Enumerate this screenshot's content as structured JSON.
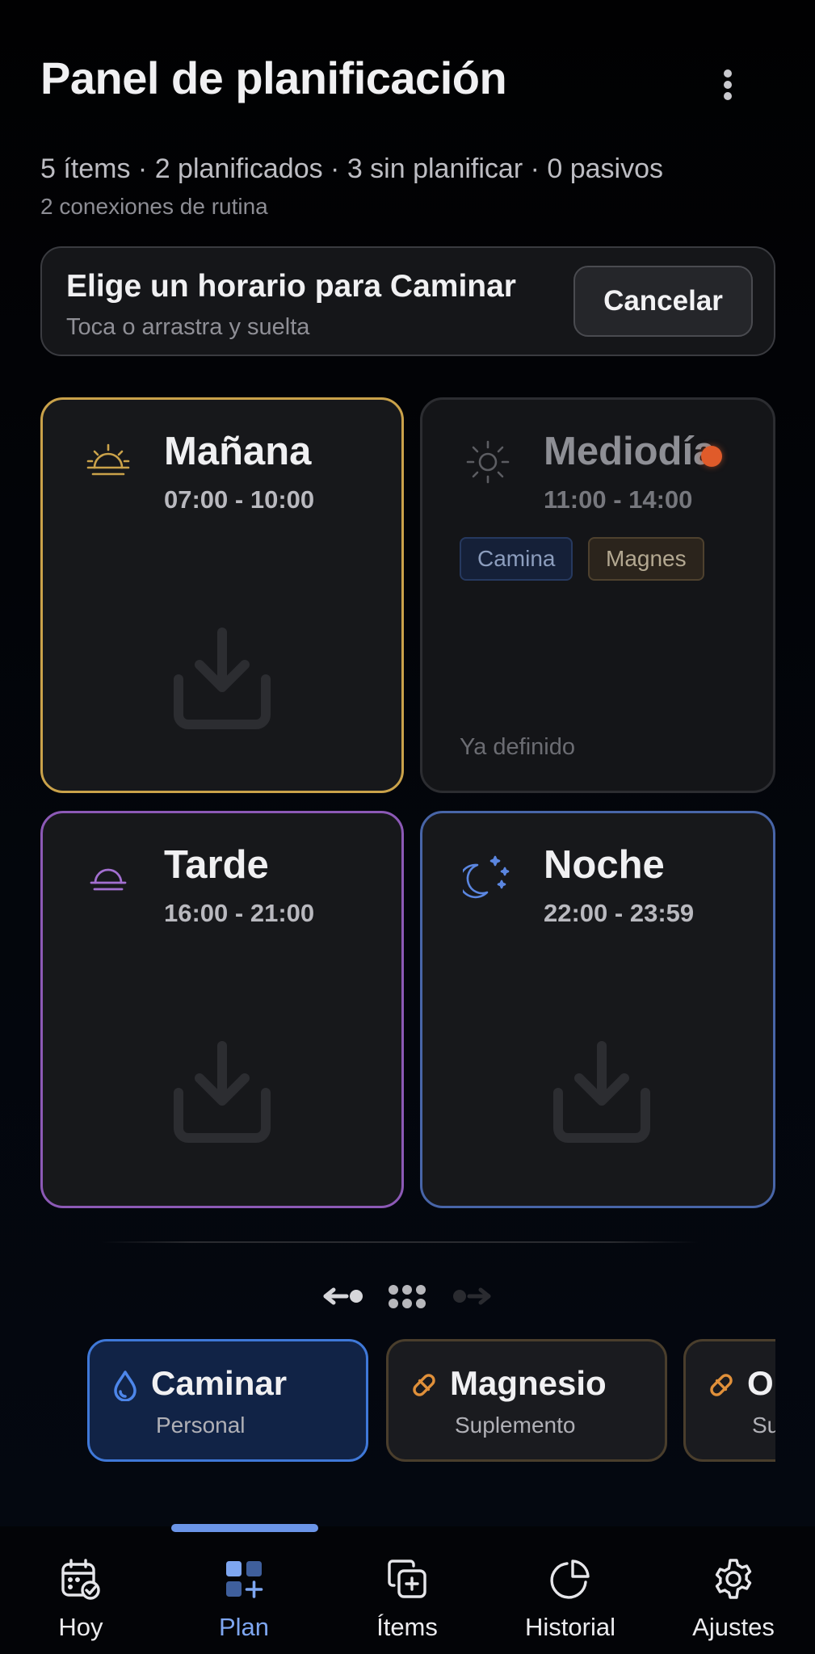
{
  "header": {
    "title": "Panel de planificación",
    "summary": "5 ítems · 2 planificados · 3 sin planificar · 0 pasivos",
    "routine_links": "2 conexiones de rutina"
  },
  "banner": {
    "title": "Elige un horario para Caminar",
    "subtitle": "Toca o arrastra y suelta",
    "cancel_label": "Cancelar"
  },
  "slots": [
    {
      "name": "Mañana",
      "range": "07:00 - 10:00",
      "icon": "sunrise-icon",
      "color": "#caa24a"
    },
    {
      "name": "Mediodía",
      "range": "11:00 - 14:00",
      "icon": "sun-icon",
      "color": "#2c2d31",
      "chips": [
        "Camina",
        "Magnes"
      ],
      "note": "Ya definido"
    },
    {
      "name": "Tarde",
      "range": "16:00 - 21:00",
      "icon": "sunset-icon",
      "color": "#8c59b6"
    },
    {
      "name": "Noche",
      "range": "22:00 - 23:59",
      "icon": "moon-stars-icon",
      "color": "#4865a8"
    }
  ],
  "items": [
    {
      "title": "Caminar",
      "subtitle": "Personal",
      "icon": "drop-icon",
      "color": "#3f78d8"
    },
    {
      "title": "Magnesio",
      "subtitle": "Suplemento",
      "icon": "pill-icon",
      "color": "#e0903a"
    },
    {
      "title": "Omega",
      "subtitle": "Suplemento",
      "icon": "pill-icon",
      "color": "#e0903a"
    }
  ],
  "nav": [
    {
      "label": "Hoy",
      "icon": "calendar-check-icon"
    },
    {
      "label": "Plan",
      "icon": "grid-plus-icon",
      "active": true
    },
    {
      "label": "Ítems",
      "icon": "copy-plus-icon"
    },
    {
      "label": "Historial",
      "icon": "pie-chart-icon"
    },
    {
      "label": "Ajustes",
      "icon": "gear-icon"
    }
  ]
}
